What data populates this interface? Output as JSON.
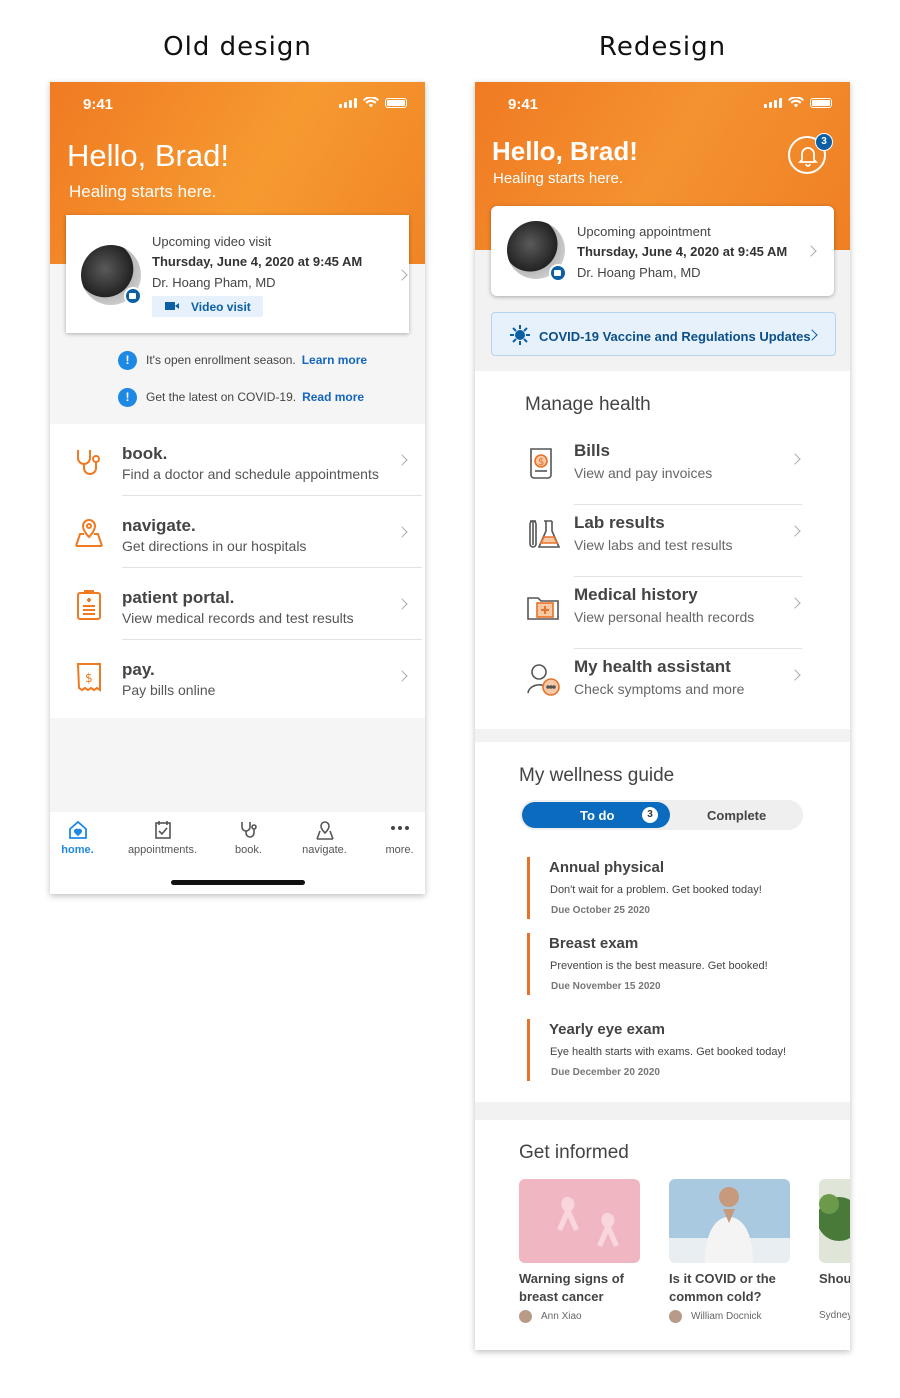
{
  "labels": {
    "old": "Old design",
    "new": "Redesign"
  },
  "status": {
    "time": "9:41"
  },
  "old": {
    "greeting": "Hello, Brad!",
    "tagline": "Healing starts here.",
    "card": {
      "type": "Upcoming video visit",
      "datetime": "Thursday, June 4, 2020 at 9:45 AM",
      "doctor": "Dr. Hoang Pham, MD",
      "button": "Video visit"
    },
    "notices": [
      {
        "text": "It's open enrollment season.",
        "link": "Learn more"
      },
      {
        "text": "Get the latest on COVID-19.",
        "link": "Read more"
      }
    ],
    "menu": [
      {
        "title": "book.",
        "subtitle": "Find a doctor and schedule appointments",
        "icon": "stethoscope-icon"
      },
      {
        "title": "navigate.",
        "subtitle": "Get directions in our hospitals",
        "icon": "map-pin-icon"
      },
      {
        "title": "patient portal.",
        "subtitle": "View medical records and test results",
        "icon": "clipboard-icon"
      },
      {
        "title": "pay.",
        "subtitle": "Pay bills online",
        "icon": "receipt-icon"
      }
    ],
    "tabs": [
      {
        "label": "home.",
        "icon": "home-heart-icon",
        "active": true
      },
      {
        "label": "appointments.",
        "icon": "calendar-check-icon",
        "active": false
      },
      {
        "label": "book.",
        "icon": "stethoscope-icon",
        "active": false
      },
      {
        "label": "navigate.",
        "icon": "map-icon",
        "active": false
      },
      {
        "label": "more.",
        "icon": "more-dots-icon",
        "active": false
      }
    ],
    "colors": {
      "accent": "#f07a22",
      "link": "#1565c0"
    }
  },
  "new": {
    "greeting": "Hello, Brad!",
    "tagline": "Healing starts here.",
    "notification_count": "3",
    "card": {
      "type": "Upcoming appointment",
      "datetime": "Thursday, June 4, 2020 at 9:45 AM",
      "doctor": "Dr. Hoang Pham, MD"
    },
    "covid_banner": "COVID-19 Vaccine and Regulations Updates",
    "manage_health": {
      "title": "Manage health",
      "items": [
        {
          "title": "Bills",
          "subtitle": "View and pay invoices",
          "icon": "bill-icon"
        },
        {
          "title": "Lab results",
          "subtitle": "View labs and test results",
          "icon": "lab-flask-icon"
        },
        {
          "title": "Medical history",
          "subtitle": "View personal health records",
          "icon": "medical-folder-icon"
        },
        {
          "title": "My health assistant",
          "subtitle": "Check symptoms and more",
          "icon": "assistant-chat-icon"
        }
      ]
    },
    "wellness": {
      "title": "My wellness guide",
      "tab_todo": "To do",
      "todo_count": "3",
      "tab_complete": "Complete",
      "items": [
        {
          "title": "Annual physical",
          "desc": "Don't wait for a problem.  Get booked today!",
          "due": "Due October 25 2020"
        },
        {
          "title": "Breast exam",
          "desc": "Prevention is the best measure. Get booked!",
          "due": "Due November 15 2020"
        },
        {
          "title": "Yearly eye exam",
          "desc": "Eye health starts with exams.  Get booked today!",
          "due": "Due December 20 2020"
        }
      ]
    },
    "informed": {
      "title": "Get informed",
      "articles": [
        {
          "title": "Warning signs of breast cancer",
          "author": "Ann Xiao"
        },
        {
          "title": "Is it COVID or the common cold?",
          "author": "William Docnick"
        },
        {
          "title": "Shou diet s",
          "author": "Sydney"
        }
      ]
    },
    "colors": {
      "accent": "#f07a22",
      "primary": "#0b6bbf"
    }
  }
}
